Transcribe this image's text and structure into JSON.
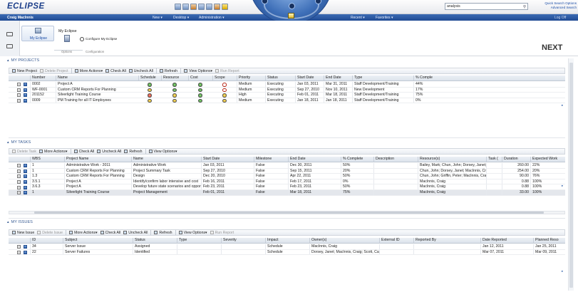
{
  "app": {
    "logo": "ECLIPSE"
  },
  "header": {
    "search_value": "analysis",
    "quick_search": "Quick Search Options",
    "advanced_search": "Advanced Search",
    "logoff": "Log Off",
    "user": "Craig MacInnis",
    "nav_left": [
      "New",
      "Desktop",
      "Administration"
    ],
    "nav_right": [
      "Recent",
      "Favorites"
    ]
  },
  "ribbon": {
    "tab_label": "My Eclipse",
    "group_title": "My Eclipse",
    "configure": "Configure My Eclipse",
    "options": "Options",
    "configuration": "Configuration"
  },
  "next_label": "NEXT",
  "projects": {
    "section_title": "MY PROJECTS",
    "toolbar": [
      {
        "label": "New Project",
        "enabled": true
      },
      {
        "label": "Delete Project",
        "enabled": false
      },
      {
        "label": "More Actions",
        "enabled": true,
        "menu": true
      },
      {
        "label": "Check All",
        "enabled": true
      },
      {
        "label": "Uncheck All",
        "enabled": true
      },
      {
        "label": "Refresh",
        "enabled": true
      },
      {
        "label": "View Options",
        "enabled": true,
        "menu": true
      },
      {
        "label": "Run Report",
        "enabled": false
      }
    ],
    "columns": [
      "Number",
      "Name",
      "Schedule",
      "Resource",
      "Cost",
      "Scope",
      "Priority",
      "Status",
      "Start Date",
      "End Date",
      "Type",
      "% Comple"
    ],
    "rows": [
      {
        "number": "0002",
        "name": "Project A",
        "schedule": "green",
        "resource": "green",
        "cost": "green",
        "scope": "redx",
        "priority": "Medium",
        "status": "Executing",
        "start": "Jan 03, 2011",
        "end": "Mar 31, 2011",
        "type": "Staff Development/Training",
        "pct": "44%"
      },
      {
        "number": "WF-0001",
        "name": "Custom CRM Reports For Planning",
        "schedule": "yellow",
        "resource": "green",
        "cost": "green",
        "scope": "redx",
        "priority": "Medium",
        "status": "Executing",
        "start": "Sep 27, 2010",
        "end": "Nov 10, 2011",
        "type": "New Development",
        "pct": "17%"
      },
      {
        "number": "201152",
        "name": "Silverlight Training Course",
        "schedule": "red",
        "resource": "yellow",
        "cost": "green",
        "scope": "yellow",
        "priority": "High",
        "status": "Executing",
        "start": "Feb 01, 2011",
        "end": "Mar 18, 2011",
        "type": "Staff Development/Training",
        "pct": "75%"
      },
      {
        "number": "0009",
        "name": "PM Training for all IT Employees",
        "schedule": "yellow",
        "resource": "yellow",
        "cost": "green",
        "scope": "yellow",
        "priority": "Medium",
        "status": "Executing",
        "start": "Jan 18, 2011",
        "end": "Jan 18, 2011",
        "type": "Staff Development/Training",
        "pct": "0%"
      }
    ]
  },
  "tasks": {
    "section_title": "MY TASKS",
    "toolbar": [
      {
        "label": "Delete Task",
        "enabled": false
      },
      {
        "label": "More Actions",
        "enabled": true,
        "menu": true
      },
      {
        "label": "Check All",
        "enabled": true
      },
      {
        "label": "Uncheck All",
        "enabled": true
      },
      {
        "label": "Refresh",
        "enabled": true
      },
      {
        "label": "View Options",
        "enabled": true,
        "menu": true
      }
    ],
    "columns": [
      "WBS",
      "Project Name",
      "Name",
      "Start Date",
      "Milestone",
      "End Date",
      "% Complete",
      "Description",
      "Resource(s)",
      "Task (",
      "Duration",
      "Expected Work"
    ],
    "rows": [
      {
        "wbs": "1",
        "project": "Administrative Work - 2011",
        "name": "Administrative Work",
        "start": "Jan 03, 2011",
        "milestone": "False",
        "end": "Dec 30, 2011",
        "pct": "50%",
        "desc": "",
        "resources": "Bailey, Mark; Chun, John; Dorsey, Janet; G",
        "task": "",
        "duration": "260.00",
        "expected": "22%"
      },
      {
        "wbs": "1",
        "project": "Custom CRM Reports For Planning",
        "name": "Project Summary Task",
        "start": "Sep 27, 2010",
        "milestone": "False",
        "end": "Sep 15, 2011",
        "pct": "20%",
        "desc": "",
        "resources": "Chun, John; Dorsey, Janet; MacInnis, Craig",
        "task": "",
        "duration": "254.00",
        "expected": "20%"
      },
      {
        "wbs": "1.3",
        "project": "Custom CRM Reports For Planning",
        "name": "Design",
        "start": "Dec 20, 2010",
        "milestone": "False",
        "end": "Apr 22, 2011",
        "pct": "50%",
        "desc": "",
        "resources": "Chun, John; Griffin, Peter; MacInnis, Craig",
        "task": "",
        "duration": "90.00",
        "expected": "76%"
      },
      {
        "wbs": "3.5.1",
        "project": "Project A",
        "name": "Identify/confirm labor intensive and cost",
        "start": "Feb 16, 2011",
        "milestone": "False",
        "end": "Feb 17, 2011",
        "pct": "0%",
        "desc": "",
        "resources": "MacInnis, Craig",
        "task": "",
        "duration": "0.88",
        "expected": "100%"
      },
      {
        "wbs": "3.6.3",
        "project": "Project A",
        "name": "Develop future state scenarios and oppor",
        "start": "Feb 23, 2011",
        "milestone": "False",
        "end": "Feb 23, 2011",
        "pct": "50%",
        "desc": "",
        "resources": "MacInnis, Craig",
        "task": "",
        "duration": "0.88",
        "expected": "100%"
      },
      {
        "wbs": "1",
        "project": "Silverlight Training Course",
        "name": "Project Management",
        "start": "Feb 01, 2011",
        "milestone": "False",
        "end": "Mar 18, 2011",
        "pct": "75%",
        "desc": "",
        "resources": "MacInnis, Craig",
        "task": "",
        "duration": "33.00",
        "expected": "100%"
      }
    ]
  },
  "issues": {
    "section_title": "MY ISSUES",
    "toolbar": [
      {
        "label": "New Issue",
        "enabled": true
      },
      {
        "label": "Delete Issue",
        "enabled": false
      },
      {
        "label": "More Actions",
        "enabled": true,
        "menu": true
      },
      {
        "label": "Check All",
        "enabled": true
      },
      {
        "label": "Uncheck All",
        "enabled": true
      },
      {
        "label": "Refresh",
        "enabled": true
      },
      {
        "label": "View Options",
        "enabled": true,
        "menu": true
      },
      {
        "label": "Run Report",
        "enabled": false
      }
    ],
    "columns": [
      "ID",
      "Subject",
      "Status",
      "Type",
      "Severity",
      "Impact",
      "Owner(s)",
      "External ID",
      "Reported By",
      "Date Reported",
      "Planned Reso"
    ],
    "rows": [
      {
        "id": "34",
        "subject": "Server Issue",
        "status": "Assigned",
        "type": "",
        "severity": "",
        "impact": "Schedule",
        "owners": "MacInnis, Craig",
        "external": "",
        "reported_by": "",
        "date": "Jan 12, 2011",
        "planned": "Jan 25, 2011"
      },
      {
        "id": "22",
        "subject": "Server Failures",
        "status": "Identified",
        "type": "",
        "severity": "",
        "impact": "Schedule",
        "owners": "Dorsey, Janet; MacInnis, Craig; Scott, Carri",
        "external": "",
        "reported_by": "",
        "date": "Mar 07, 2011",
        "planned": "Mar 09, 2011"
      }
    ]
  },
  "colors": {
    "brand": "#1d3f8a",
    "nav": "#2a5aa5",
    "section": "#3a5d94",
    "link": "#1d4fa8"
  }
}
